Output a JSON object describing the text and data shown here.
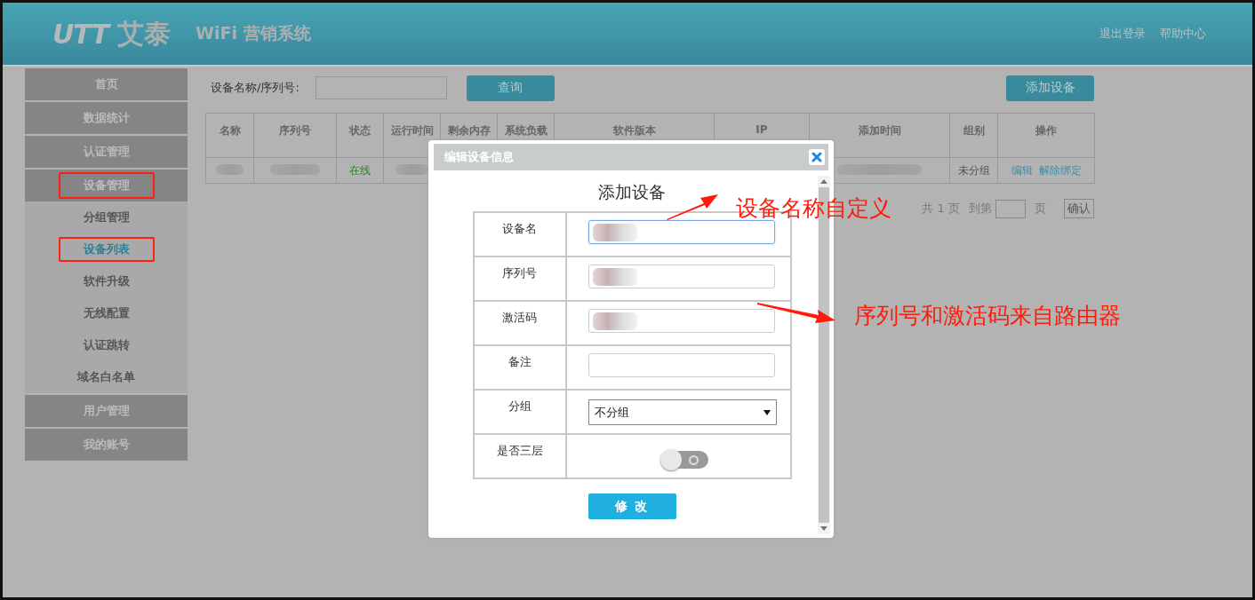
{
  "header": {
    "logo": {
      "mark": "UTT",
      "name": "艾泰"
    },
    "title": "WiFi 营销系统",
    "links": [
      "退出登录",
      "帮助中心"
    ]
  },
  "sidebar": {
    "items": [
      {
        "label": "首页",
        "highlighted": false
      },
      {
        "label": "数据统计",
        "highlighted": false
      },
      {
        "label": "认证管理",
        "highlighted": false
      },
      {
        "label": "设备管理",
        "highlighted": true,
        "expanded": true,
        "children": [
          {
            "label": "分组管理",
            "selected": false,
            "highlighted": false
          },
          {
            "label": "设备列表",
            "selected": true,
            "highlighted": true
          },
          {
            "label": "软件升级",
            "selected": false,
            "highlighted": false
          },
          {
            "label": "无线配置",
            "selected": false,
            "highlighted": false
          },
          {
            "label": "认证跳转",
            "selected": false,
            "highlighted": false
          },
          {
            "label": "域名白名单",
            "selected": false,
            "highlighted": false
          }
        ]
      },
      {
        "label": "用户管理",
        "highlighted": false
      },
      {
        "label": "我的账号",
        "highlighted": false
      }
    ]
  },
  "search": {
    "label": "设备名称/序列号:",
    "button": "查询"
  },
  "add_button": "添加设备",
  "table": {
    "columns": [
      "名称",
      "序列号",
      "状态",
      "运行时间",
      "剩余内存",
      "系统负载",
      "软件版本",
      "IP",
      "添加时间",
      "组别",
      "操作"
    ],
    "rows": [
      {
        "cells": [
          {
            "kind": "redacted"
          },
          {
            "kind": "redacted"
          },
          {
            "kind": "status",
            "text": "在线"
          },
          {
            "kind": "redacted"
          },
          {
            "kind": "empty"
          },
          {
            "kind": "empty"
          },
          {
            "kind": "empty"
          },
          {
            "kind": "empty"
          },
          {
            "kind": "redacted"
          },
          {
            "kind": "text",
            "text": "未分组"
          },
          {
            "kind": "actions",
            "links": [
              "编辑",
              "解除绑定"
            ]
          }
        ]
      }
    ]
  },
  "pagination": {
    "total": "共 1 页",
    "goto": "到第",
    "unit": "页",
    "confirm": "确认"
  },
  "dialog": {
    "title": "编辑设备信息",
    "heading": "添加设备",
    "fields": [
      {
        "label": "设备名",
        "kind": "text",
        "focused": true,
        "redacted": true
      },
      {
        "label": "序列号",
        "kind": "text",
        "focused": false,
        "redacted": true
      },
      {
        "label": "激活码",
        "kind": "text",
        "focused": false,
        "redacted": true
      },
      {
        "label": "备注",
        "kind": "text",
        "focused": false,
        "redacted": false
      },
      {
        "label": "分组",
        "kind": "select",
        "value": "不分组"
      },
      {
        "label": "是否三层",
        "kind": "toggle",
        "on": false
      }
    ],
    "submit": "修 改"
  },
  "annotations": [
    {
      "text": "设备名称自定义",
      "kind": "name"
    },
    {
      "text": "序列号和激活码来自路由器",
      "kind": "serial"
    }
  ]
}
